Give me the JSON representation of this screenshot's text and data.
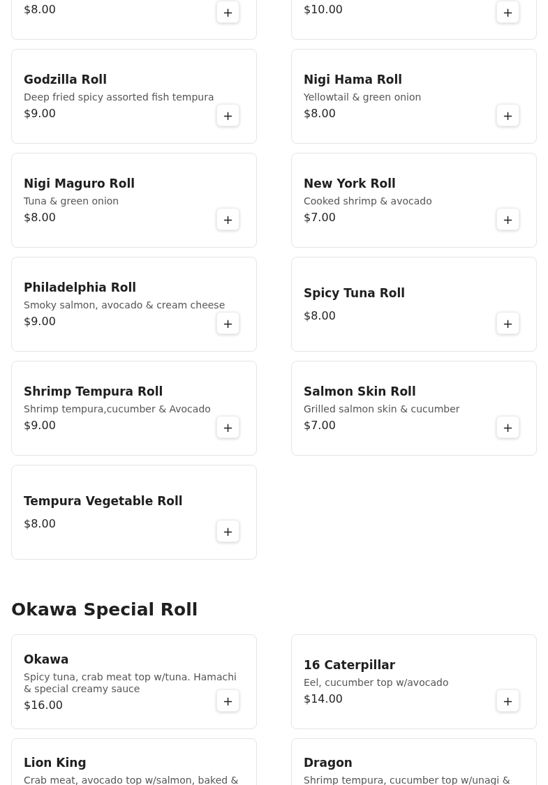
{
  "sections": [
    {
      "items": [
        {
          "price": "$8.00",
          "button": "+",
          "cut_top": true
        },
        {
          "price": "$10.00",
          "button": "+",
          "cut_top": true
        },
        {
          "name": "Godzilla Roll",
          "description": "Deep fried spicy assorted fish tempura",
          "price": "$9.00",
          "button": "+"
        },
        {
          "name": "Nigi Hama Roll",
          "description": "Yellowtail & green onion",
          "price": "$8.00",
          "button": "+"
        },
        {
          "name": "Nigi Maguro Roll",
          "description": "Tuna & green onion",
          "price": "$8.00",
          "button": "+"
        },
        {
          "name": "New York Roll",
          "description": "Cooked shrimp & avocado",
          "price": "$7.00",
          "button": "+"
        },
        {
          "name": "Philadelphia Roll",
          "description": "Smoky salmon, avocado & cream cheese",
          "price": "$9.00",
          "button": "+"
        },
        {
          "name": "Spicy Tuna Roll",
          "price": "$8.00",
          "button": "+"
        },
        {
          "name": "Shrimp Tempura Roll",
          "description": "Shrimp tempura,cucumber & Avocado",
          "price": "$9.00",
          "button": "+"
        },
        {
          "name": "Salmon Skin Roll",
          "description": "Grilled salmon skin & cucumber",
          "price": "$7.00",
          "button": "+"
        },
        {
          "name": "Tempura Vegetable Roll",
          "price": "$8.00",
          "button": "+"
        }
      ]
    },
    {
      "title": "Okawa Special Roll",
      "items": [
        {
          "name": "Okawa",
          "description": "Spicy tuna, crab meat top w/tuna. Hamachi & special creamy sauce",
          "price": "$16.00",
          "button": "+"
        },
        {
          "name": "16 Caterpillar",
          "description": "Eel, cucumber top w/avocado",
          "price": "$14.00",
          "button": "+"
        },
        {
          "name": "Lion King",
          "description": "Crab meat, avocado top w/salmon, baked &",
          "cut_bottom": true
        },
        {
          "name": "Dragon",
          "description": "Shrimp tempura, cucumber top w/unagi &",
          "cut_bottom": true
        }
      ]
    }
  ]
}
